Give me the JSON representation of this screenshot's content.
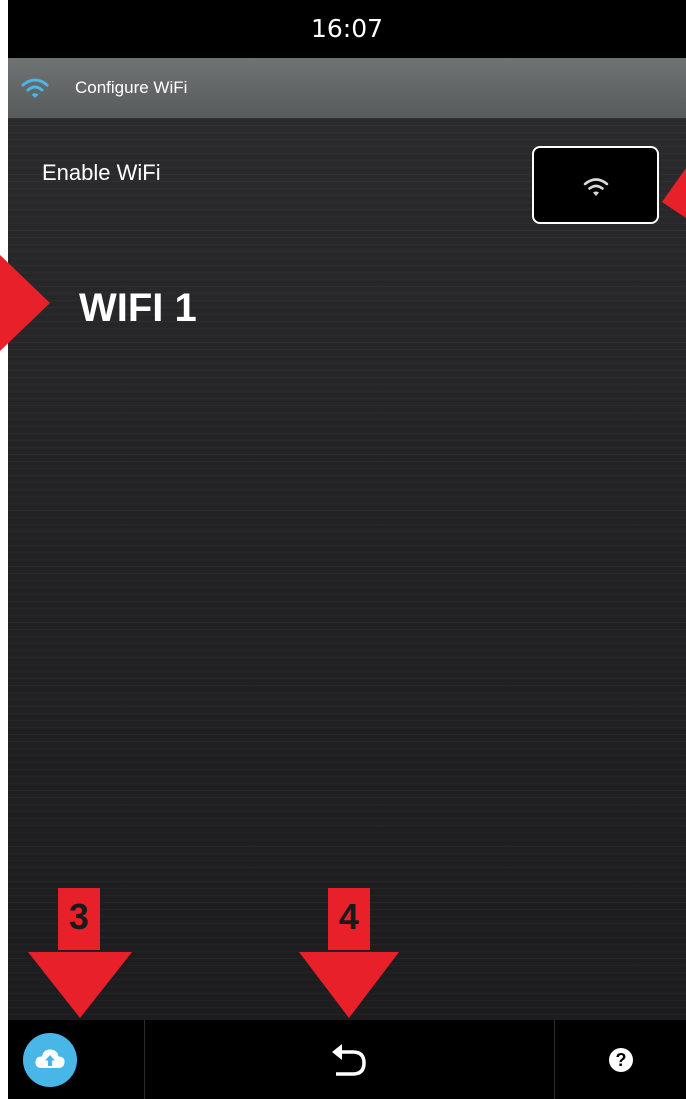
{
  "status_bar": {
    "time": "16:07"
  },
  "title_bar": {
    "icon": "wifi-icon",
    "title": "Configure WiFi"
  },
  "settings": {
    "enable_wifi_label": "Enable WiFi",
    "toggle_icon": "wifi-icon",
    "network_heading": "WIFI 1"
  },
  "bottom_bar": {
    "cloud_icon": "cloud-upload-icon",
    "back_icon": "back-arrow-icon",
    "help_label": "?"
  },
  "annotations": {
    "label_3": "3",
    "label_4": "4"
  },
  "colors": {
    "accent_blue": "#49b6e8",
    "annotation_red": "#e8202a",
    "status_bar": "#000000",
    "title_bar": "#626667"
  }
}
